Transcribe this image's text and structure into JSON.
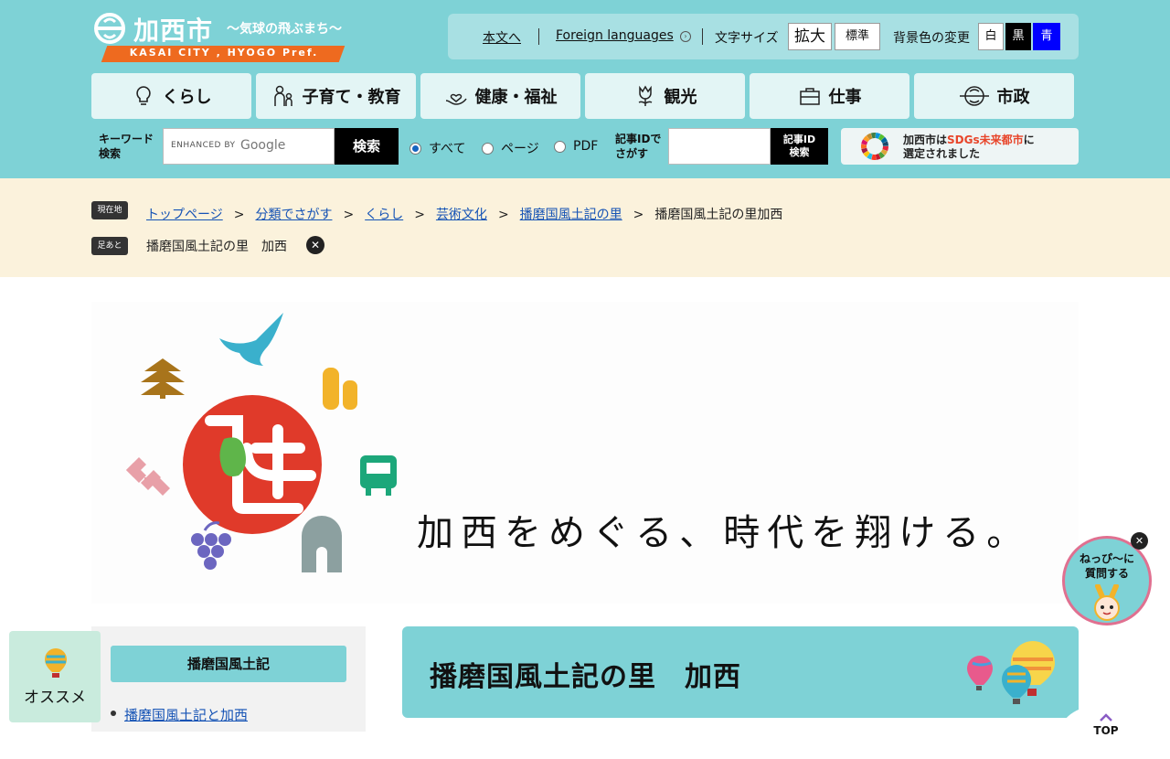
{
  "header": {
    "logo_title": "加西市",
    "logo_tagline": "～気球の飛ぶまち～",
    "logo_band": "KASAI CITY , HYOGO Pref.",
    "util": {
      "honbun": "本文へ",
      "foreign": "Foreign languages",
      "size_label": "文字サイズ",
      "size_large": "拡大",
      "size_std": "標準",
      "bg_label": "背景色の変更",
      "bg_white": "白",
      "bg_black": "黒",
      "bg_blue": "青"
    },
    "nav": [
      {
        "label": "くらし",
        "icon": "lightbulb-icon"
      },
      {
        "label": "子育て・教育",
        "icon": "parent-child-icon"
      },
      {
        "label": "健康・福祉",
        "icon": "caring-hand-icon"
      },
      {
        "label": "観光",
        "icon": "tulip-icon"
      },
      {
        "label": "仕事",
        "icon": "briefcase-icon"
      },
      {
        "label": "市政",
        "icon": "city-logo-icon"
      }
    ],
    "search": {
      "keyword_label_1": "キーワード",
      "keyword_label_2": "検索",
      "enhanced": "ENHANCED BY",
      "google": "Google",
      "button": "検索",
      "radios": [
        "すべて",
        "ページ",
        "PDF"
      ],
      "selected": "すべて",
      "id_label_1": "記事IDで",
      "id_label_2": "さがす",
      "id_btn_1": "記事ID",
      "id_btn_2": "検索"
    },
    "sdgs": {
      "line1_a": "加西市は",
      "line1_b": "SDGs未来都市",
      "line1_c": "に",
      "line2": "選定されました"
    }
  },
  "breadcrumb": {
    "current_badge": "現在地",
    "items": [
      "トップページ",
      "分類でさがす",
      "くらし",
      "芸術文化",
      "播磨国風土記の里"
    ],
    "current": "播磨国風土記の里加西",
    "footprint_badge": "足あと",
    "footprint_a": "播磨国風土記の里",
    "footprint_b": "加西"
  },
  "hero": {
    "catchphrase": "加西をめぐる、時代を翔ける。"
  },
  "sidebar": {
    "heading": "播磨国風土記",
    "links": [
      "播磨国風土記と加西"
    ]
  },
  "main": {
    "title": "播磨国風土記の里　加西"
  },
  "floating": {
    "osusume": "オススメ",
    "neppy_1": "ねっぴ～に",
    "neppy_2": "質問する",
    "top": "TOP"
  },
  "colors": {
    "header_bg": "#7ed2d6",
    "logo_band": "#ee6a1f",
    "crumb_bg": "#fbf2dc",
    "link": "#1553b5",
    "hero_red": "#e03a2a",
    "sdgs_accent": "#e8452a"
  }
}
